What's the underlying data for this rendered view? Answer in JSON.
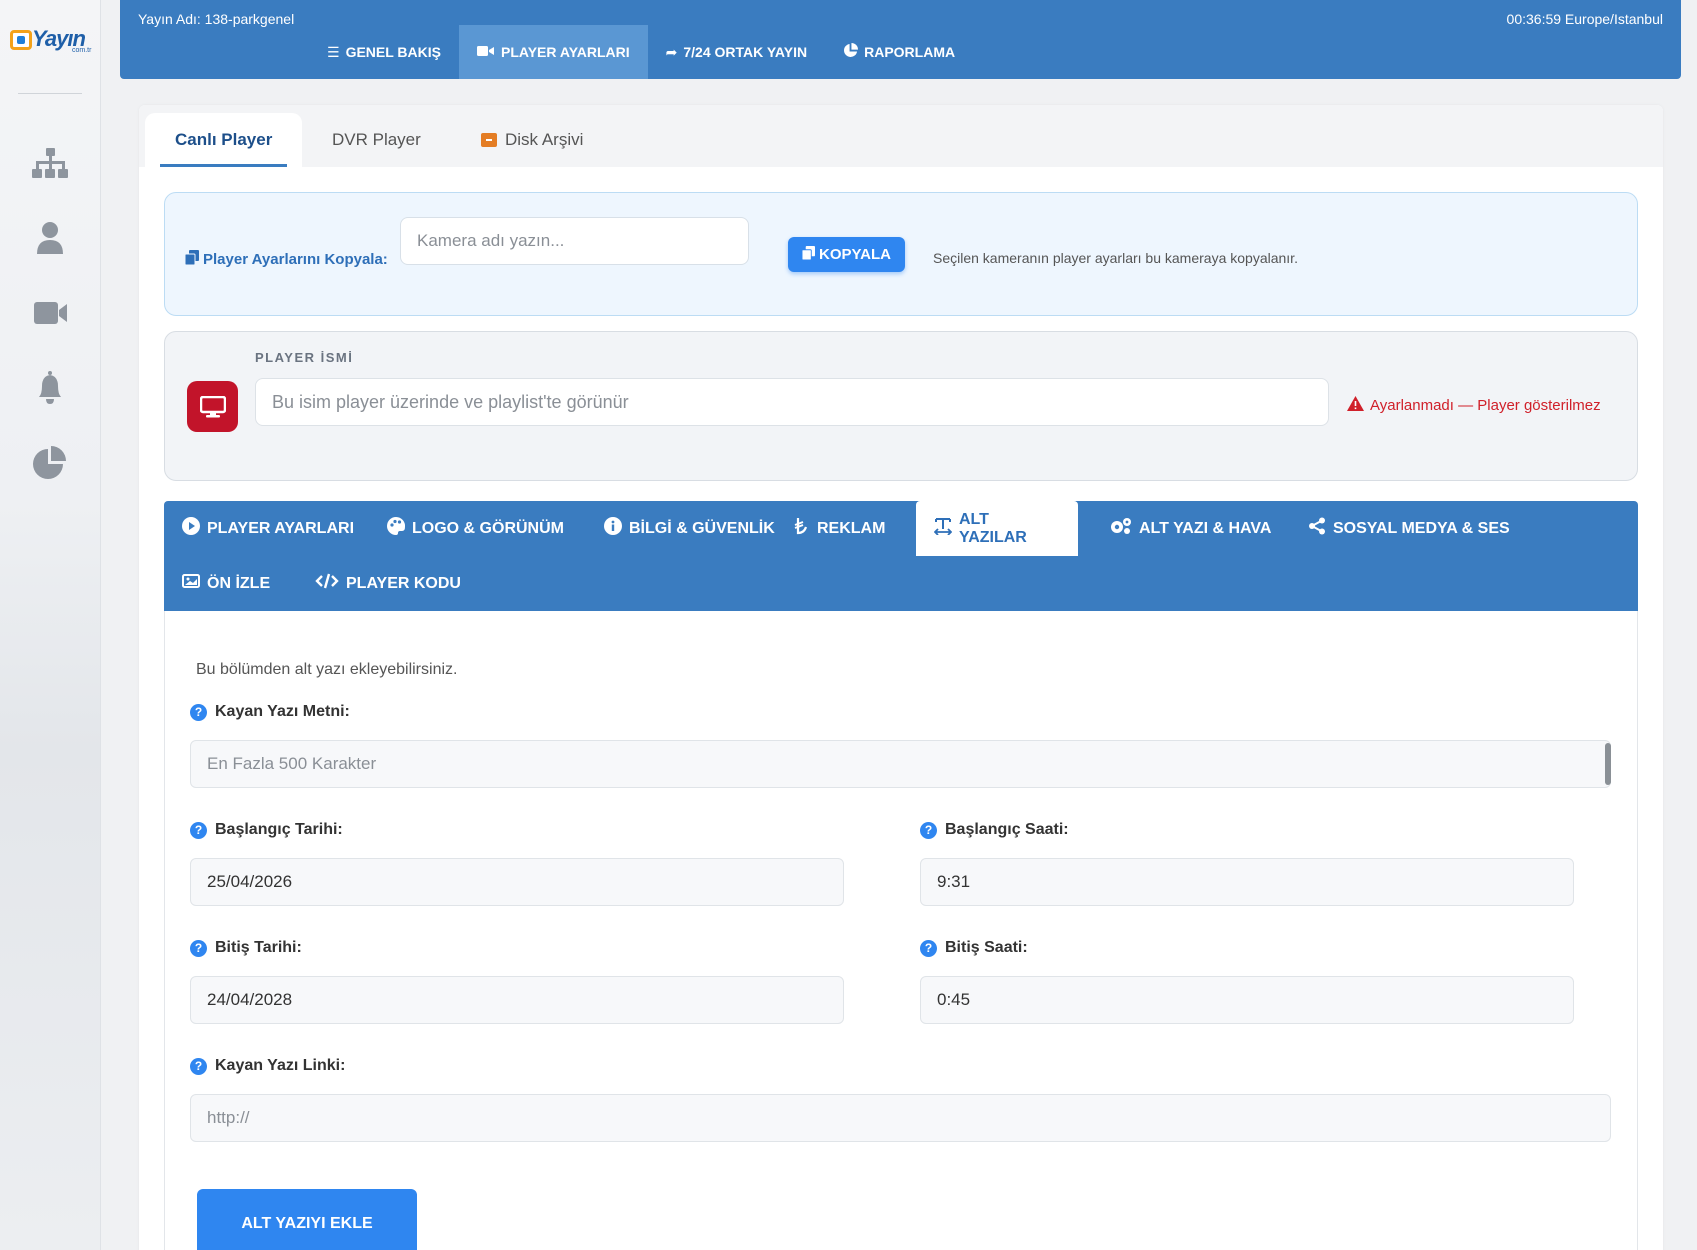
{
  "header": {
    "yayin_name": "Yayın Adı: 138-parkgenel",
    "clock": "00:36:59 Europe/Istanbul",
    "nav": [
      {
        "label": "GENEL BAKIŞ",
        "icon": "bars-icon"
      },
      {
        "label": "PLAYER AYARLARI",
        "icon": "video-icon"
      },
      {
        "label": "7/24 ORTAK YAYIN",
        "icon": "share-icon"
      },
      {
        "label": "RAPORLAMA",
        "icon": "chart-pie-icon"
      }
    ]
  },
  "logo": {
    "word": "Yayın",
    "sub": "com.tr"
  },
  "sidebar": {
    "icons": [
      "sitemap-icon",
      "user-icon",
      "video-camera-icon",
      "bell-icon",
      "chart-pie-icon"
    ]
  },
  "main_tabs": [
    {
      "label": "Canlı Player"
    },
    {
      "label": "DVR Player"
    },
    {
      "label": "Disk Arşivi"
    }
  ],
  "copy": {
    "label": "Player Ayarlarını Kopyala:",
    "placeholder": "Kamera adı yazın...",
    "button": "KOPYALA",
    "hint": "Seçilen kameranın player ayarları bu kameraya kopyalanır."
  },
  "player_name": {
    "label": "PLAYER İSMİ",
    "placeholder": "Bu isim player üzerinde ve playlist'te görünür",
    "warning": "Ayarlanmadı — Player gösterilmez"
  },
  "settings_tabs": [
    {
      "label": "PLAYER AYARLARI",
      "icon": "play-circle-icon"
    },
    {
      "label": "LOGO & GÖRÜNÜM",
      "icon": "palette-icon"
    },
    {
      "label": "BİLGİ & GÜVENLİK",
      "icon": "info-circle-icon"
    },
    {
      "label": "REKLAM",
      "icon": "lira-icon"
    },
    {
      "label": "ALT YAZILAR",
      "icon": "subtitle-icon"
    },
    {
      "label": "ALT YAZI & HAVA",
      "icon": "gears-icon"
    },
    {
      "label": "SOSYAL MEDYA & SES",
      "icon": "share-nodes-icon"
    },
    {
      "label": "ÖN İZLE",
      "icon": "image-icon"
    },
    {
      "label": "PLAYER KODU",
      "icon": "code-icon"
    }
  ],
  "form": {
    "intro": "Bu bölümden alt yazı ekleyebilirsiniz.",
    "kayan_label": "Kayan Yazı Metni:",
    "kayan_placeholder": "En Fazla 500 Karakter",
    "start_date_label": "Başlangıç Tarihi:",
    "start_date_value": "25/04/2026",
    "start_time_label": "Başlangıç Saati:",
    "start_time_value": "9:31",
    "end_date_label": "Bitiş Tarihi:",
    "end_date_value": "24/04/2028",
    "end_time_label": "Bitiş Saati:",
    "end_time_value": "0:45",
    "link_label": "Kayan Yazı Linki:",
    "link_placeholder": "http://",
    "submit": "ALT YAZIYI EKLE"
  },
  "colors": {
    "primary": "#3a7cc0",
    "button": "#2f86f0",
    "danger": "#c2142a",
    "warning_text": "#d0202a"
  }
}
